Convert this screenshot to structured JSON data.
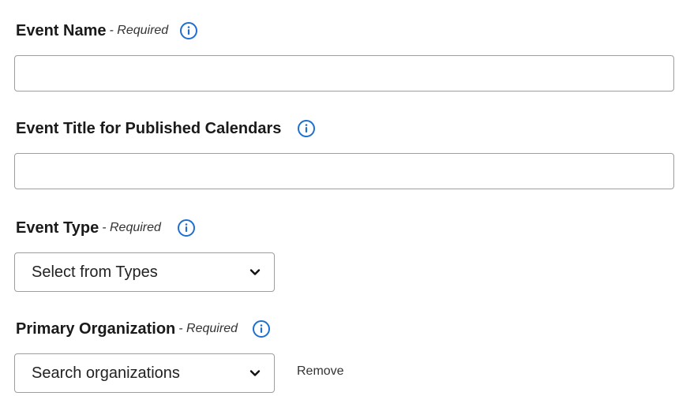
{
  "event_name": {
    "label": "Event Name",
    "required": "- Required",
    "value": "",
    "placeholder": ""
  },
  "event_title": {
    "label": "Event Title for Published Calendars",
    "value": "",
    "placeholder": ""
  },
  "event_type": {
    "label": "Event Type",
    "required": "- Required",
    "selected": "Select from Types"
  },
  "primary_org": {
    "label": "Primary Organization",
    "required": "- Required",
    "selected": "Search organizations",
    "remove_label": "Remove"
  },
  "colors": {
    "info_icon": "#1f6fd1",
    "border": "#9e9e9e",
    "text": "#1a1a1a"
  },
  "icons": {
    "info": "info-circle-icon",
    "dropdown": "chevron-down-icon"
  }
}
